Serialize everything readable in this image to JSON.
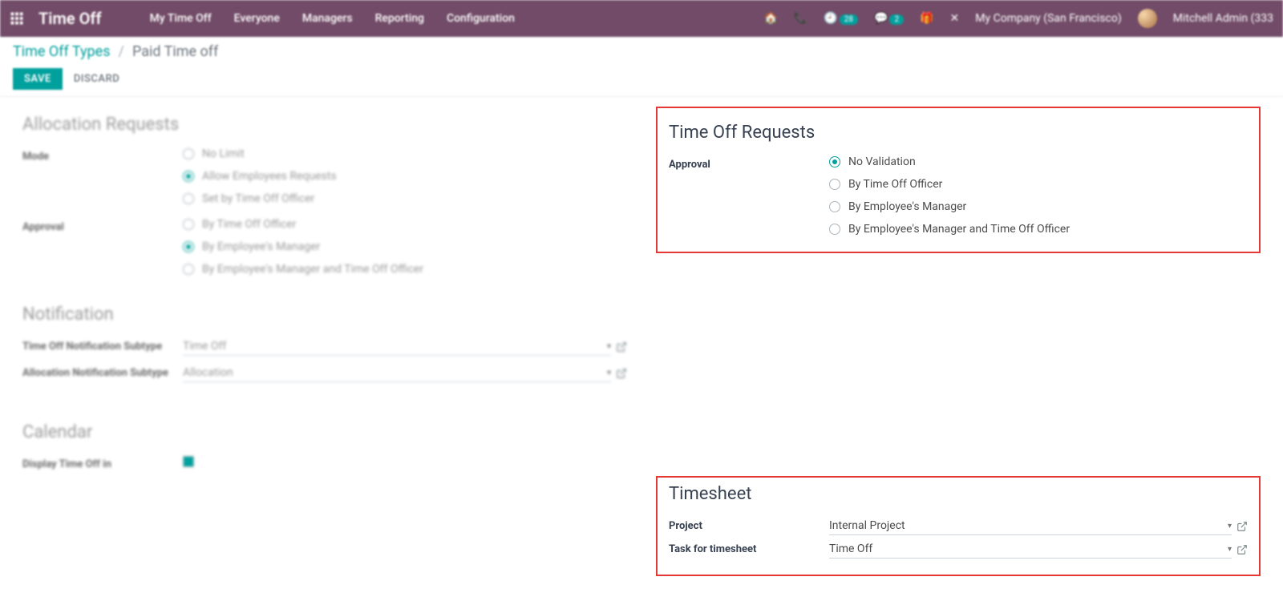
{
  "nav": {
    "brand": "Time Off",
    "menu": [
      "My Time Off",
      "Everyone",
      "Managers",
      "Reporting",
      "Configuration"
    ],
    "company": "My Company (San Francisco)",
    "user": "Mitchell Admin (333",
    "badge1": "28",
    "badge2": "2"
  },
  "crumbs": {
    "root": "Time Off Types",
    "sep": "/",
    "current": "Paid Time off"
  },
  "actions": {
    "save": "SAVE",
    "discard": "DISCARD"
  },
  "left": {
    "alloc": {
      "title": "Allocation Requests",
      "mode_label": "Mode",
      "mode_options": {
        "no_limit": "No Limit",
        "allow": "Allow Employees Requests",
        "set": "Set by Time Off Officer"
      },
      "approval_label": "Approval",
      "approval_options": {
        "officer": "By Time Off Officer",
        "manager": "By Employee's Manager",
        "both": "By Employee's Manager and Time Off Officer"
      }
    },
    "notif": {
      "title": "Notification",
      "to_label": "Time Off Notification Subtype",
      "to_value": "Time Off",
      "alloc_label": "Allocation Notification Subtype",
      "alloc_value": "Allocation"
    },
    "cal": {
      "title": "Calendar",
      "display_label": "Display Time Off in"
    }
  },
  "right": {
    "req": {
      "title": "Time Off Requests",
      "approval_label": "Approval",
      "options": {
        "none": "No Validation",
        "officer": "By Time Off Officer",
        "manager": "By Employee's Manager",
        "both": "By Employee's Manager and Time Off Officer"
      }
    },
    "ts": {
      "title": "Timesheet",
      "project_label": "Project",
      "project_value": "Internal Project",
      "task_label": "Task for timesheet",
      "task_value": "Time Off"
    }
  }
}
